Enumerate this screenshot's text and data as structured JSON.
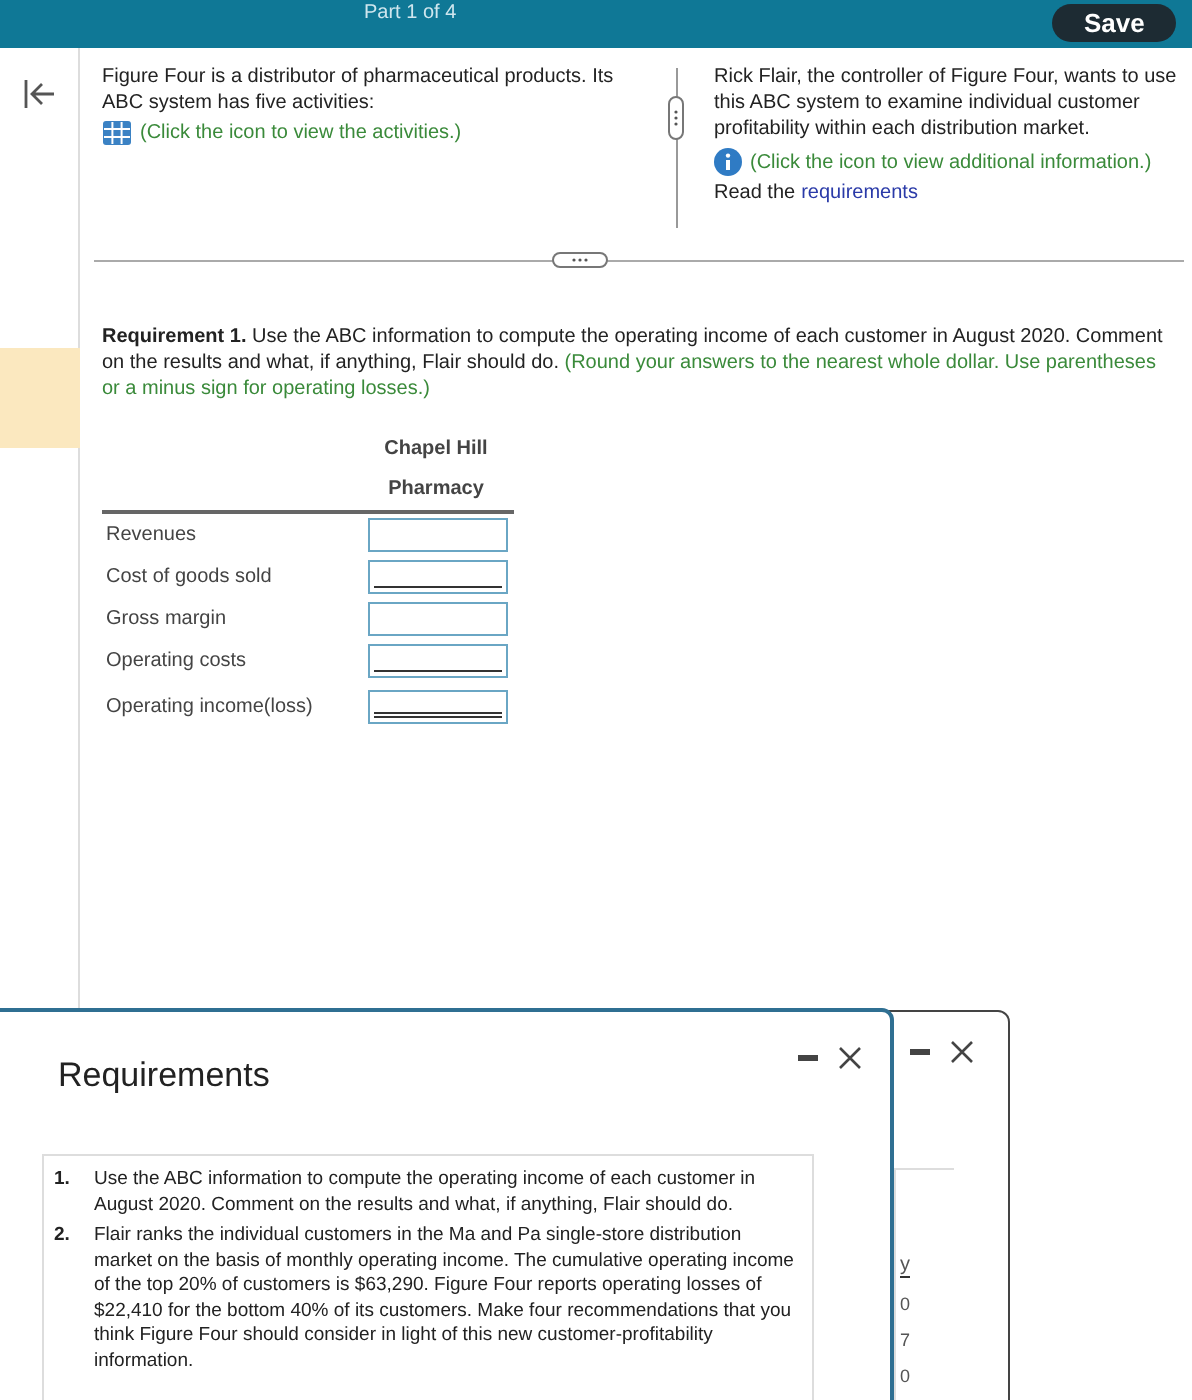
{
  "header": {
    "progress": "Part 1 of 4",
    "save_button": "Save"
  },
  "left_panel": {
    "text": "Figure Four is a distributor of pharmaceutical products. Its ABC system has five activities:",
    "link": "(Click the icon to view the activities.)"
  },
  "right_panel": {
    "text": "Rick Flair, the controller of Figure Four, wants to use this ABC system to examine individual customer profitability within each distribution market.",
    "link": "(Click the icon to view additional information.)",
    "read_prefix": "Read the",
    "read_link": "requirements"
  },
  "requirement": {
    "text": "**Requirement 1.** Use the ABC information to compute the operating income of each customer in August 2020. Comment on the results and what, if anything, Flair should do.",
    "hint": "(Round your answers to the nearest whole dollar. Use parentheses or a minus sign for operating losses.)"
  },
  "table": {
    "column": "Chapel Hill Pharmacy",
    "rows": [
      {
        "label": "Revenues",
        "kind": "plain"
      },
      {
        "label": "Cost of goods sold",
        "kind": "single"
      },
      {
        "label": "Gross margin",
        "kind": "plain"
      },
      {
        "label": "Operating costs",
        "kind": "single"
      },
      {
        "label": "Operating income(loss)",
        "kind": "double"
      }
    ]
  },
  "back_window": {
    "heading": "y",
    "cells": [
      "0",
      "7",
      "0"
    ]
  },
  "requirements_window": {
    "title": "Requirements",
    "items": [
      {
        "number": "1.",
        "text": "Use the ABC information to compute the operating income of each customer in August 2020. Comment on the results and what, if anything, Flair should do."
      },
      {
        "number": "2.",
        "text": "Flair ranks the individual customers in the Ma and Pa single-store distribution market on the basis of monthly operating income. The cumulative operating income of the top 20% of customers is $63,290. Figure Four reports operating losses of $22,410 for the bottom 40% of its customers. Make four recommendations that you think Figure Four should consider in light of this new customer-profitability information."
      }
    ]
  }
}
